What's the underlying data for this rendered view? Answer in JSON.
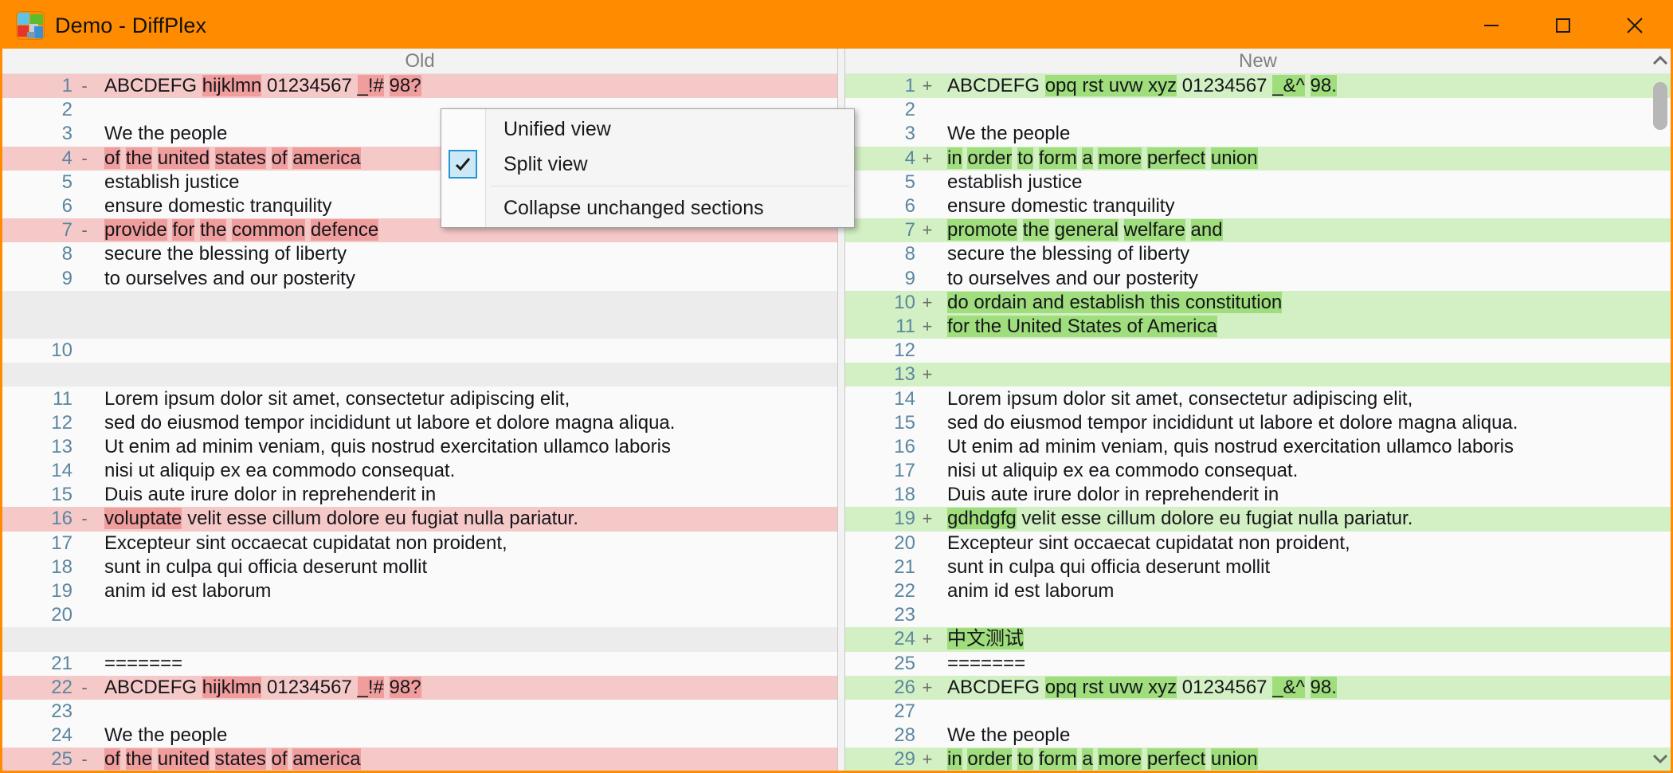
{
  "window": {
    "title": "Demo - DiffPlex",
    "app_icon": "diffplex-squares-icon",
    "minimize_label": "─",
    "maximize_label": "□",
    "close_label": "✕",
    "accent_color": "#ff8c00"
  },
  "panes": {
    "left_header": "Old",
    "right_header": "New"
  },
  "context_menu": {
    "items": [
      {
        "label": "Unified view",
        "checked": false
      },
      {
        "label": "Split view",
        "checked": true
      },
      {
        "label": "Collapse unchanged sections",
        "checked": false
      }
    ],
    "check_glyph": "✔"
  },
  "colors": {
    "deleted_line_bg": "#f6c9c9",
    "deleted_word_bg": "#ef9d9d",
    "inserted_line_bg": "#d3f0c4",
    "inserted_word_bg": "#9fdd7d",
    "filler_bg": "#ececec",
    "line_number_color": "#5b86a0"
  },
  "left_lines": [
    {
      "num": "1",
      "type": "del",
      "sign": "-",
      "parts": [
        {
          "t": "ABCDEFG ",
          "h": false
        },
        {
          "t": "hijklmn",
          "h": true
        },
        {
          "t": " 01234567 ",
          "h": false
        },
        {
          "t": "_!#",
          "h": true
        },
        {
          "t": " ",
          "h": false
        },
        {
          "t": "98?",
          "h": true
        }
      ]
    },
    {
      "num": "2",
      "type": "ctx",
      "sign": "",
      "parts": []
    },
    {
      "num": "3",
      "type": "ctx",
      "sign": "",
      "parts": [
        {
          "t": "We the people",
          "h": false
        }
      ]
    },
    {
      "num": "4",
      "type": "del",
      "sign": "-",
      "parts": [
        {
          "t": "of",
          "h": true
        },
        {
          "t": " ",
          "h": false
        },
        {
          "t": "the",
          "h": true
        },
        {
          "t": " ",
          "h": false
        },
        {
          "t": "united",
          "h": true
        },
        {
          "t": " ",
          "h": false
        },
        {
          "t": "states",
          "h": true
        },
        {
          "t": " ",
          "h": false
        },
        {
          "t": "of",
          "h": true
        },
        {
          "t": " ",
          "h": false
        },
        {
          "t": "america",
          "h": true
        }
      ]
    },
    {
      "num": "5",
      "type": "ctx",
      "sign": "",
      "parts": [
        {
          "t": "establish justice",
          "h": false
        }
      ]
    },
    {
      "num": "6",
      "type": "ctx",
      "sign": "",
      "parts": [
        {
          "t": "ensure domestic tranquility",
          "h": false
        }
      ]
    },
    {
      "num": "7",
      "type": "del",
      "sign": "-",
      "parts": [
        {
          "t": "provide",
          "h": true
        },
        {
          "t": " ",
          "h": false
        },
        {
          "t": "for",
          "h": true
        },
        {
          "t": " ",
          "h": false
        },
        {
          "t": "the",
          "h": true
        },
        {
          "t": " ",
          "h": false
        },
        {
          "t": "common",
          "h": true
        },
        {
          "t": " ",
          "h": false
        },
        {
          "t": "defence",
          "h": true
        }
      ]
    },
    {
      "num": "8",
      "type": "ctx",
      "sign": "",
      "parts": [
        {
          "t": "secure the blessing of liberty",
          "h": false
        }
      ]
    },
    {
      "num": "9",
      "type": "ctx",
      "sign": "",
      "parts": [
        {
          "t": "to ourselves and our posterity",
          "h": false
        }
      ]
    },
    {
      "num": "",
      "type": "filler",
      "sign": "",
      "parts": []
    },
    {
      "num": "",
      "type": "filler",
      "sign": "",
      "parts": []
    },
    {
      "num": "10",
      "type": "ctx",
      "sign": "",
      "parts": []
    },
    {
      "num": "",
      "type": "filler",
      "sign": "",
      "parts": []
    },
    {
      "num": "11",
      "type": "ctx",
      "sign": "",
      "parts": [
        {
          "t": "Lorem ipsum dolor sit amet, consectetur adipiscing elit,",
          "h": false
        }
      ]
    },
    {
      "num": "12",
      "type": "ctx",
      "sign": "",
      "parts": [
        {
          "t": "sed do eiusmod tempor incididunt ut labore et dolore magna aliqua.",
          "h": false
        }
      ]
    },
    {
      "num": "13",
      "type": "ctx",
      "sign": "",
      "parts": [
        {
          "t": "Ut enim ad minim veniam, quis nostrud exercitation ullamco laboris",
          "h": false
        }
      ]
    },
    {
      "num": "14",
      "type": "ctx",
      "sign": "",
      "parts": [
        {
          "t": "nisi ut aliquip ex ea commodo consequat.",
          "h": false
        }
      ]
    },
    {
      "num": "15",
      "type": "ctx",
      "sign": "",
      "parts": [
        {
          "t": "Duis aute irure dolor in reprehenderit in",
          "h": false
        }
      ]
    },
    {
      "num": "16",
      "type": "del",
      "sign": "-",
      "parts": [
        {
          "t": "voluptate",
          "h": true
        },
        {
          "t": " velit esse cillum dolore eu fugiat nulla pariatur.",
          "h": false
        }
      ]
    },
    {
      "num": "17",
      "type": "ctx",
      "sign": "",
      "parts": [
        {
          "t": "Excepteur sint occaecat cupidatat non proident,",
          "h": false
        }
      ]
    },
    {
      "num": "18",
      "type": "ctx",
      "sign": "",
      "parts": [
        {
          "t": "sunt in culpa qui officia deserunt mollit",
          "h": false
        }
      ]
    },
    {
      "num": "19",
      "type": "ctx",
      "sign": "",
      "parts": [
        {
          "t": "anim id est laborum",
          "h": false
        }
      ]
    },
    {
      "num": "20",
      "type": "ctx",
      "sign": "",
      "parts": []
    },
    {
      "num": "",
      "type": "filler",
      "sign": "",
      "parts": []
    },
    {
      "num": "21",
      "type": "ctx",
      "sign": "",
      "parts": [
        {
          "t": "=======",
          "h": false
        }
      ]
    },
    {
      "num": "22",
      "type": "del",
      "sign": "-",
      "parts": [
        {
          "t": "ABCDEFG ",
          "h": false
        },
        {
          "t": "hijklmn",
          "h": true
        },
        {
          "t": " 01234567 ",
          "h": false
        },
        {
          "t": "_!#",
          "h": true
        },
        {
          "t": " ",
          "h": false
        },
        {
          "t": "98?",
          "h": true
        }
      ]
    },
    {
      "num": "23",
      "type": "ctx",
      "sign": "",
      "parts": []
    },
    {
      "num": "24",
      "type": "ctx",
      "sign": "",
      "parts": [
        {
          "t": "We the people",
          "h": false
        }
      ]
    },
    {
      "num": "25",
      "type": "del",
      "sign": "-",
      "parts": [
        {
          "t": "of",
          "h": true
        },
        {
          "t": " ",
          "h": false
        },
        {
          "t": "the",
          "h": true
        },
        {
          "t": " ",
          "h": false
        },
        {
          "t": "united",
          "h": true
        },
        {
          "t": " ",
          "h": false
        },
        {
          "t": "states",
          "h": true
        },
        {
          "t": " ",
          "h": false
        },
        {
          "t": "of",
          "h": true
        },
        {
          "t": " ",
          "h": false
        },
        {
          "t": "america",
          "h": true
        }
      ]
    }
  ],
  "right_lines": [
    {
      "num": "1",
      "type": "ins",
      "sign": "+",
      "parts": [
        {
          "t": "ABCDEFG ",
          "h": false
        },
        {
          "t": "opq rst uvw xyz",
          "h": true
        },
        {
          "t": " 01234567 ",
          "h": false
        },
        {
          "t": "_&^",
          "h": true
        },
        {
          "t": " ",
          "h": false
        },
        {
          "t": "98.",
          "h": true
        }
      ]
    },
    {
      "num": "2",
      "type": "ctx",
      "sign": "",
      "parts": []
    },
    {
      "num": "3",
      "type": "ctx",
      "sign": "",
      "parts": [
        {
          "t": "We the people",
          "h": false
        }
      ]
    },
    {
      "num": "4",
      "type": "ins",
      "sign": "+",
      "parts": [
        {
          "t": "in",
          "h": true
        },
        {
          "t": " ",
          "h": false
        },
        {
          "t": "order",
          "h": true
        },
        {
          "t": " ",
          "h": false
        },
        {
          "t": "to",
          "h": true
        },
        {
          "t": " ",
          "h": false
        },
        {
          "t": "form",
          "h": true
        },
        {
          "t": " ",
          "h": false
        },
        {
          "t": "a",
          "h": true
        },
        {
          "t": " ",
          "h": false
        },
        {
          "t": "more",
          "h": true
        },
        {
          "t": " ",
          "h": false
        },
        {
          "t": "perfect",
          "h": true
        },
        {
          "t": " ",
          "h": false
        },
        {
          "t": "union",
          "h": true
        }
      ]
    },
    {
      "num": "5",
      "type": "ctx",
      "sign": "",
      "parts": [
        {
          "t": "establish justice",
          "h": false
        }
      ]
    },
    {
      "num": "6",
      "type": "ctx",
      "sign": "",
      "parts": [
        {
          "t": "ensure domestic tranquility",
          "h": false
        }
      ]
    },
    {
      "num": "7",
      "type": "ins",
      "sign": "+",
      "parts": [
        {
          "t": "promote",
          "h": true
        },
        {
          "t": " ",
          "h": false
        },
        {
          "t": "the",
          "h": true
        },
        {
          "t": " ",
          "h": false
        },
        {
          "t": "general",
          "h": true
        },
        {
          "t": " ",
          "h": false
        },
        {
          "t": "welfare",
          "h": true
        },
        {
          "t": " ",
          "h": false
        },
        {
          "t": "and",
          "h": true
        }
      ]
    },
    {
      "num": "8",
      "type": "ctx",
      "sign": "",
      "parts": [
        {
          "t": "secure the blessing of liberty",
          "h": false
        }
      ]
    },
    {
      "num": "9",
      "type": "ctx",
      "sign": "",
      "parts": [
        {
          "t": "to ourselves and our posterity",
          "h": false
        }
      ]
    },
    {
      "num": "10",
      "type": "ins",
      "sign": "+",
      "parts": [
        {
          "t": "do ordain and establish this constitution",
          "h": true
        }
      ]
    },
    {
      "num": "11",
      "type": "ins",
      "sign": "+",
      "parts": [
        {
          "t": "for the United States of America",
          "h": true
        }
      ]
    },
    {
      "num": "12",
      "type": "ctx",
      "sign": "",
      "parts": []
    },
    {
      "num": "13",
      "type": "ins",
      "sign": "+",
      "parts": []
    },
    {
      "num": "14",
      "type": "ctx",
      "sign": "",
      "parts": [
        {
          "t": "Lorem ipsum dolor sit amet, consectetur adipiscing elit,",
          "h": false
        }
      ]
    },
    {
      "num": "15",
      "type": "ctx",
      "sign": "",
      "parts": [
        {
          "t": "sed do eiusmod tempor incididunt ut labore et dolore magna aliqua.",
          "h": false
        }
      ]
    },
    {
      "num": "16",
      "type": "ctx",
      "sign": "",
      "parts": [
        {
          "t": "Ut enim ad minim veniam, quis nostrud exercitation ullamco laboris",
          "h": false
        }
      ]
    },
    {
      "num": "17",
      "type": "ctx",
      "sign": "",
      "parts": [
        {
          "t": "nisi ut aliquip ex ea commodo consequat.",
          "h": false
        }
      ]
    },
    {
      "num": "18",
      "type": "ctx",
      "sign": "",
      "parts": [
        {
          "t": "Duis aute irure dolor in reprehenderit in",
          "h": false
        }
      ]
    },
    {
      "num": "19",
      "type": "ins",
      "sign": "+",
      "parts": [
        {
          "t": "gdhdgfg",
          "h": true
        },
        {
          "t": " velit esse cillum dolore eu fugiat nulla pariatur.",
          "h": false
        }
      ]
    },
    {
      "num": "20",
      "type": "ctx",
      "sign": "",
      "parts": [
        {
          "t": "Excepteur sint occaecat cupidatat non proident,",
          "h": false
        }
      ]
    },
    {
      "num": "21",
      "type": "ctx",
      "sign": "",
      "parts": [
        {
          "t": "sunt in culpa qui officia deserunt mollit",
          "h": false
        }
      ]
    },
    {
      "num": "22",
      "type": "ctx",
      "sign": "",
      "parts": [
        {
          "t": "anim id est laborum",
          "h": false
        }
      ]
    },
    {
      "num": "23",
      "type": "ctx",
      "sign": "",
      "parts": []
    },
    {
      "num": "24",
      "type": "ins",
      "sign": "+",
      "parts": [
        {
          "t": "中文测试",
          "h": true
        }
      ]
    },
    {
      "num": "25",
      "type": "ctx",
      "sign": "",
      "parts": [
        {
          "t": "=======",
          "h": false
        }
      ]
    },
    {
      "num": "26",
      "type": "ins",
      "sign": "+",
      "parts": [
        {
          "t": "ABCDEFG ",
          "h": false
        },
        {
          "t": "opq rst uvw xyz",
          "h": true
        },
        {
          "t": " 01234567 ",
          "h": false
        },
        {
          "t": "_&^",
          "h": true
        },
        {
          "t": " ",
          "h": false
        },
        {
          "t": "98.",
          "h": true
        }
      ]
    },
    {
      "num": "27",
      "type": "ctx",
      "sign": "",
      "parts": []
    },
    {
      "num": "28",
      "type": "ctx",
      "sign": "",
      "parts": [
        {
          "t": "We the people",
          "h": false
        }
      ]
    },
    {
      "num": "29",
      "type": "ins",
      "sign": "+",
      "parts": [
        {
          "t": "in",
          "h": true
        },
        {
          "t": " ",
          "h": false
        },
        {
          "t": "order",
          "h": true
        },
        {
          "t": " ",
          "h": false
        },
        {
          "t": "to",
          "h": true
        },
        {
          "t": " ",
          "h": false
        },
        {
          "t": "form",
          "h": true
        },
        {
          "t": " ",
          "h": false
        },
        {
          "t": "a",
          "h": true
        },
        {
          "t": " ",
          "h": false
        },
        {
          "t": "more",
          "h": true
        },
        {
          "t": " ",
          "h": false
        },
        {
          "t": "perfect",
          "h": true
        },
        {
          "t": " ",
          "h": false
        },
        {
          "t": "union",
          "h": true
        }
      ]
    }
  ],
  "scrollbar": {
    "up_arrow": "scroll-up-chevron",
    "down_arrow": "scroll-down-chevron"
  }
}
